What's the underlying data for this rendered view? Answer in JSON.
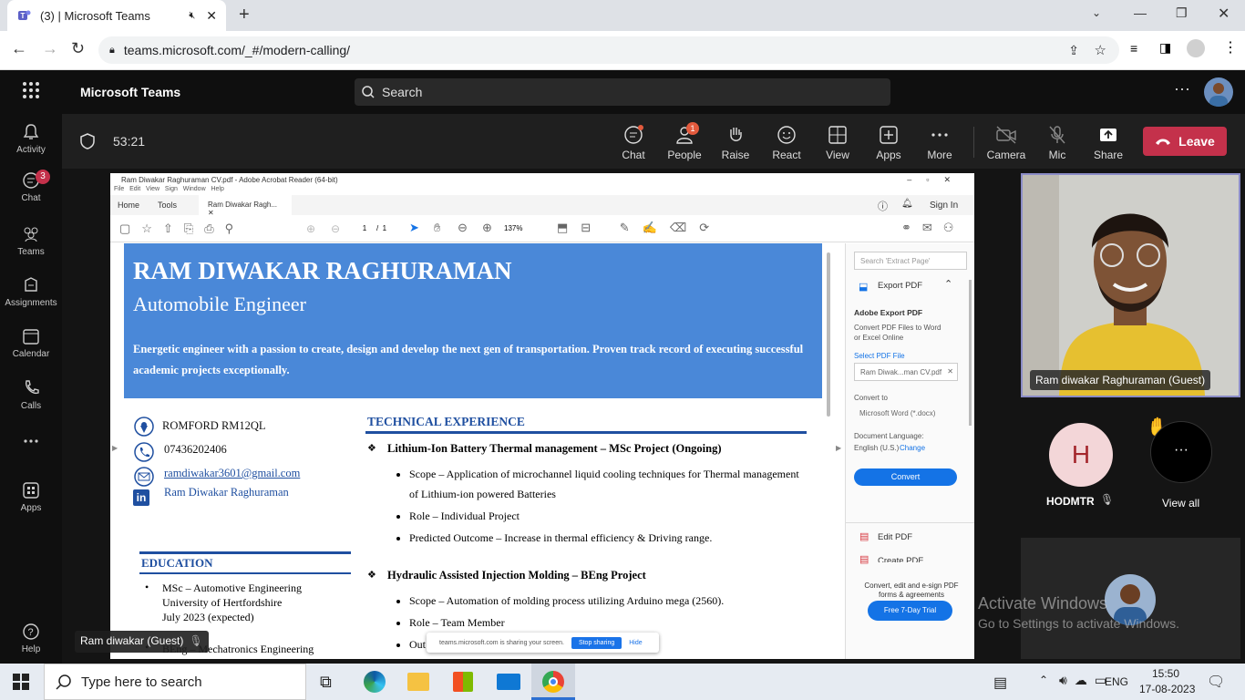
{
  "browser": {
    "tab_title": "(3) | Microsoft Teams",
    "url": "teams.microsoft.com/_#/modern-calling/"
  },
  "teams": {
    "app_name": "Microsoft Teams",
    "search_placeholder": "Search",
    "rail": [
      {
        "label": "Activity",
        "icon": "bell-icon"
      },
      {
        "label": "Chat",
        "icon": "chat-icon",
        "badge": "3"
      },
      {
        "label": "Teams",
        "icon": "teams-icon"
      },
      {
        "label": "Assignments",
        "icon": "assignments-icon"
      },
      {
        "label": "Calendar",
        "icon": "calendar-icon"
      },
      {
        "label": "Calls",
        "icon": "phone-icon"
      },
      {
        "label": "...",
        "icon": "more-icon"
      },
      {
        "label": "Apps",
        "icon": "apps-icon"
      },
      {
        "label": "Help",
        "icon": "help-icon"
      }
    ]
  },
  "call": {
    "timer": "53:21",
    "buttons": [
      {
        "label": "Chat"
      },
      {
        "label": "People",
        "badge": "1"
      },
      {
        "label": "Raise"
      },
      {
        "label": "React"
      },
      {
        "label": "View"
      },
      {
        "label": "Apps"
      },
      {
        "label": "More"
      },
      {
        "label": "Camera"
      },
      {
        "label": "Mic"
      },
      {
        "label": "Share"
      }
    ],
    "leave": "Leave",
    "presenter_name": "Ram diwakar (Guest)",
    "video_name": "Ram diwakar Raghuraman (Guest)",
    "participant_initial": "H",
    "participant_name": "HODMTR",
    "view_all": "View all",
    "sharing_text": "teams.microsoft.com is sharing your screen.",
    "stop_sharing": "Stop sharing",
    "hide": "Hide",
    "activate_1": "Activate Windows",
    "activate_2": "Go to Settings to activate Windows."
  },
  "acrobat": {
    "title": "Ram Diwakar Raghuraman CV.pdf - Adobe Acrobat Reader (64-bit)",
    "menu": "File   Edit   View   Sign   Window   Help",
    "tab_home": "Home",
    "tab_tools": "Tools",
    "tab_doc": "Ram Diwakar Ragh...",
    "sign_in": "Sign In",
    "page": "1",
    "page_total": "/  1",
    "zoom": "137%",
    "panel": {
      "search": "Search 'Extract Page'",
      "export": "Export PDF",
      "adobe_export": "Adobe Export PDF",
      "convert_desc": "Convert PDF Files to Word or Excel Online",
      "select": "Select PDF File",
      "file": "Ram Diwak...man CV.pdf",
      "convert_to": "Convert to",
      "format": "Microsoft Word (*.docx)",
      "doc_lang": "Document Language:",
      "lang": "English (U.S.)",
      "change": "Change",
      "convert_btn": "Convert",
      "edit": "Edit PDF",
      "create": "Create PDF",
      "promo": "Convert, edit and e-sign PDF forms & agreements",
      "trial": "Free 7-Day Trial"
    }
  },
  "cv": {
    "name": "RAM DIWAKAR RAGHURAMAN",
    "title": "Automobile Engineer",
    "summary": "Energetic engineer with a passion to create, design and develop the next gen of transportation. Proven track record of executing successful academic projects exceptionally.",
    "address": "ROMFORD RM12QL",
    "phone": "07436202406",
    "email": "ramdiwakar3601@gmail.com",
    "linkedin": "Ram Diwakar Raghuraman",
    "edu_heading": "EDUCATION",
    "edu1_a": "MSc – Automotive Engineering",
    "edu1_b": "University of Hertfordshire",
    "edu1_c": "July 2023 (expected)",
    "edu2": "BEng – Mechatronics Engineering",
    "tech_heading": "TECHNICAL EXPERIENCE",
    "p1": "Lithium-Ion Battery Thermal management – MSc Project (Ongoing)",
    "p1b1": "Scope – Application of microchannel liquid cooling techniques for Thermal management of Lithium-ion powered Batteries",
    "p1b2": "Role – Individual Project",
    "p1b3": "Predicted Outcome – Increase in thermal efficiency & Driving range.",
    "p2": "Hydraulic Assisted Injection Molding – BEng Project",
    "p2b1": "Scope – Automation of molding process utilizing Arduino mega (2560).",
    "p2b2": "Role – Team Member",
    "p2b3": "Out"
  },
  "taskbar": {
    "search": "Type here to search",
    "lang": "ENG",
    "time": "15:50",
    "date": "17-08-2023"
  }
}
